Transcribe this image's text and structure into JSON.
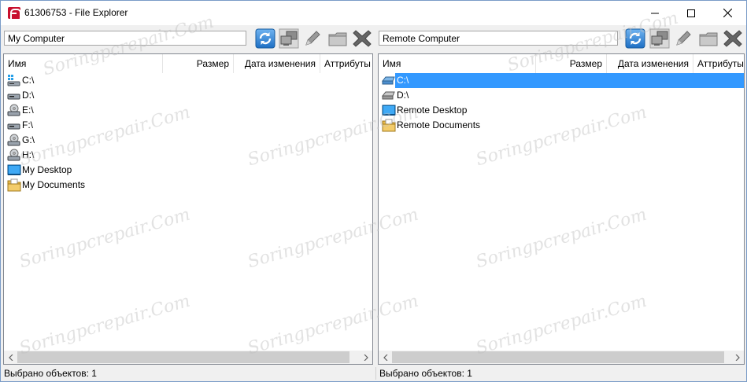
{
  "window": {
    "title": "61306753 - File Explorer"
  },
  "left_pane": {
    "path": "My Computer",
    "columns": [
      {
        "label": "Имя"
      },
      {
        "label": "Размер"
      },
      {
        "label": "Дата изменения"
      },
      {
        "label": "Аттрибуты"
      }
    ],
    "items": [
      {
        "label": "C:\\",
        "icon": "windows-drive-icon"
      },
      {
        "label": "D:\\",
        "icon": "hard-drive-icon"
      },
      {
        "label": "E:\\",
        "icon": "cd-drive-icon"
      },
      {
        "label": "F:\\",
        "icon": "hard-drive-icon"
      },
      {
        "label": "G:\\",
        "icon": "cd-drive-icon"
      },
      {
        "label": "H:\\",
        "icon": "cd-drive-icon"
      },
      {
        "label": "My Desktop",
        "icon": "desktop-icon"
      },
      {
        "label": "My Documents",
        "icon": "documents-folder-icon"
      }
    ],
    "status": "Выбрано объектов: 1"
  },
  "right_pane": {
    "path": "Remote Computer",
    "columns": [
      {
        "label": "Имя"
      },
      {
        "label": "Размер"
      },
      {
        "label": "Дата изменения"
      },
      {
        "label": "Аттрибуты"
      }
    ],
    "items": [
      {
        "label": "C:\\",
        "icon": "network-drive-icon",
        "selected": true
      },
      {
        "label": "D:\\",
        "icon": "hard-drive-icon"
      },
      {
        "label": "Remote Desktop",
        "icon": "desktop-icon"
      },
      {
        "label": "Remote Documents",
        "icon": "documents-folder-icon"
      }
    ],
    "status": "Выбрано объектов: 1"
  },
  "toolbar": {
    "buttons": [
      {
        "name": "refresh",
        "icon": "refresh-icon"
      },
      {
        "name": "transfer",
        "icon": "computer-transfer-icon"
      },
      {
        "name": "rename",
        "icon": "pencil-icon"
      },
      {
        "name": "new-folder",
        "icon": "folder-icon"
      },
      {
        "name": "delete",
        "icon": "delete-x-icon"
      }
    ]
  },
  "colors": {
    "selection": "#3399ff",
    "window_border": "#7a9cc7",
    "app_icon": "#c8102e"
  },
  "watermark": {
    "text": "Soringpcrepair.Com"
  }
}
